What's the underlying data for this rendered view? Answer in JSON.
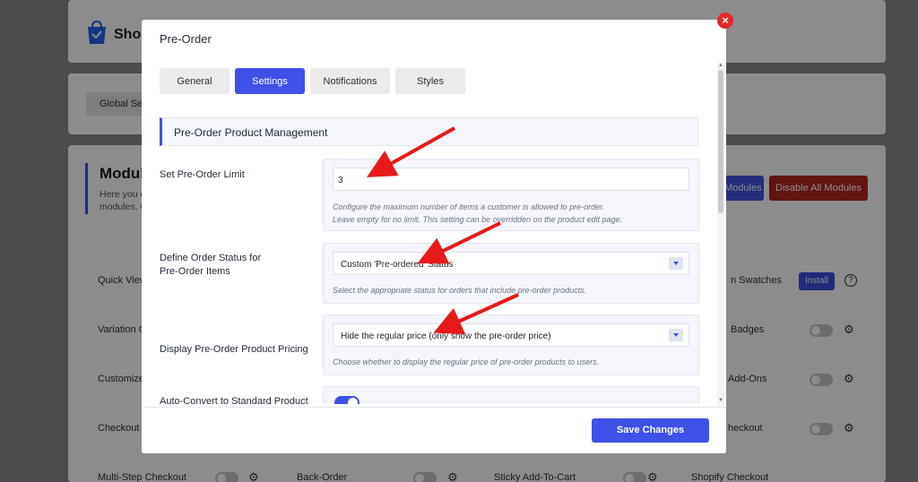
{
  "background": {
    "store_name": "Shop",
    "global_settings_label": "Global Sett",
    "modules_title": "Module",
    "modules_desc": [
      "Here you c",
      "modules. C"
    ],
    "enable_all_label": "Modules",
    "disable_all_label": "Disable All Modules",
    "left_modules": [
      "Quick View",
      "Variation G",
      "Customize",
      "Checkout F"
    ],
    "right_modules": [
      "n Swatches",
      "Badges",
      "Add-Ons",
      "heckout"
    ],
    "install_label": "Install",
    "help_glyph": "?",
    "bottom_modules": [
      "Multi-Step Checkout",
      "Back-Order",
      "Sticky Add-To-Cart",
      "Shopify Checkout"
    ]
  },
  "modal": {
    "title": "Pre-Order",
    "close_glyph": "×",
    "tabs": [
      {
        "label": "General",
        "active": false
      },
      {
        "label": "Settings",
        "active": true
      },
      {
        "label": "Notifications",
        "active": false
      },
      {
        "label": "Styles",
        "active": false
      }
    ],
    "section_title": "Pre-Order Product Management",
    "fields": {
      "limit": {
        "label": "Set Pre-Order Limit",
        "value": "3",
        "help": [
          "Configure the maximum number of items a customer is allowed to pre-order.",
          "Leave empty for no limit. This setting can be overridden on the product edit page."
        ]
      },
      "order_status": {
        "label": [
          "Define Order Status for",
          "Pre-Order Items"
        ],
        "value": "Custom 'Pre-ordered' Status",
        "help": "Select the appropriate status for orders that include pre-order products."
      },
      "pricing": {
        "label": "Display Pre-Order Product Pricing",
        "value": "Hide the regular price (only show the pre-order price)",
        "help": "Choose whether to display the regular price of pre-order products to users."
      },
      "auto_convert": {
        "label": "Auto-Convert to Standard Product",
        "enabled": true
      }
    },
    "save_label": "Save Changes"
  },
  "colors": {
    "accent": "#3f51e9",
    "danger": "#e5282b",
    "annotation_arrow": "#e8191b"
  },
  "icons": [
    "store-bag-icon",
    "close-icon",
    "gear-icon",
    "help-icon",
    "chevron-down-icon",
    "annotation-arrow-icon"
  ]
}
